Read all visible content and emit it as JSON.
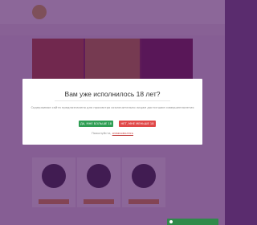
{
  "modal": {
    "title": "Вам уже исполнилось 18 лет?",
    "description": "Содержимое сайта предназначено для просмотра исключительно лицам достигшим совершеннолетия",
    "yes_label": "ДА, МНЕ БОЛЬШЕ 18",
    "no_label": "НЕТ, МНЕ МЕНЬШЕ 18",
    "policy_text": "Пожалуйста, ",
    "policy_link": "ознакомьтесь"
  },
  "colors": {
    "overlay": "#460a5a",
    "yes": "#2f9e54",
    "no": "#e04848"
  }
}
